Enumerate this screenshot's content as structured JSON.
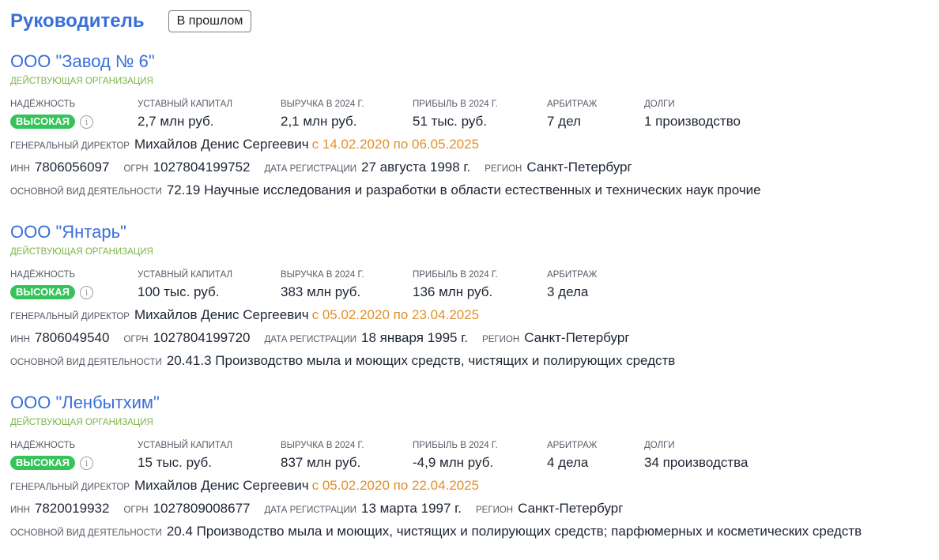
{
  "header": {
    "title": "Руководитель",
    "past_button": "В прошлом"
  },
  "labels": {
    "reliability": "НАДЁЖНОСТЬ",
    "capital": "УСТАВНЫЙ КАПИТАЛ",
    "revenue": "ВЫРУЧКА В 2024 Г.",
    "profit": "ПРИБЫЛЬ В 2024 Г.",
    "arbitration": "АРБИТРАЖ",
    "debts": "ДОЛГИ",
    "director": "ГЕНЕРАЛЬНЫЙ ДИРЕКТОР",
    "inn": "ИНН",
    "ogrn": "ОГРН",
    "reg_date": "ДАТА РЕГИСТРАЦИИ",
    "region": "РЕГИОН",
    "activity": "ОСНОВНОЙ ВИД ДЕЯТЕЛЬНОСТИ"
  },
  "companies": [
    {
      "name": "ООО \"Завод № 6\"",
      "status": "ДЕЙСТВУЮЩАЯ ОРГАНИЗАЦИЯ",
      "reliability": "ВЫСОКАЯ",
      "capital": "2,7 млн руб.",
      "revenue": "2,1 млн руб.",
      "profit": "51 тыс. руб.",
      "arbitration": "7 дел",
      "debts": "1 производство",
      "director": "Михайлов Денис Сергеевич",
      "period": "с 14.02.2020 по 06.05.2025",
      "inn": "7806056097",
      "ogrn": "1027804199752",
      "reg_date": "27 августа 1998 г.",
      "region": "Санкт-Петербург",
      "activity": "72.19 Научные исследования и разработки в области естественных и технических наук прочие"
    },
    {
      "name": "ООО \"Янтарь\"",
      "status": "ДЕЙСТВУЮЩАЯ ОРГАНИЗАЦИЯ",
      "reliability": "ВЫСОКАЯ",
      "capital": "100 тыс. руб.",
      "revenue": "383 млн руб.",
      "profit": "136 млн руб.",
      "arbitration": "3 дела",
      "director": "Михайлов Денис Сергеевич",
      "period": "с 05.02.2020 по 23.04.2025",
      "inn": "7806049540",
      "ogrn": "1027804199720",
      "reg_date": "18 января 1995 г.",
      "region": "Санкт-Петербург",
      "activity": "20.41.3 Производство мыла и моющих средств, чистящих и полирующих средств"
    },
    {
      "name": "ООО \"Ленбытхим\"",
      "status": "ДЕЙСТВУЮЩАЯ ОРГАНИЗАЦИЯ",
      "reliability": "ВЫСОКАЯ",
      "capital": "15 тыс. руб.",
      "revenue": "837 млн руб.",
      "profit": "-4,9 млн руб.",
      "arbitration": "4 дела",
      "debts": "34 производства",
      "director": "Михайлов Денис Сергеевич",
      "period": "с 05.02.2020 по 22.04.2025",
      "inn": "7820019932",
      "ogrn": "1027809008677",
      "reg_date": "13 марта 1997 г.",
      "region": "Санкт-Петербург",
      "activity": "20.4 Производство мыла и моющих, чистящих и полирующих средств; парфюмерных и косметических средств"
    }
  ],
  "icons": {
    "info": "info-icon"
  },
  "colors": {
    "link": "#3a6fd8",
    "status": "#7db44a",
    "badge": "#35c35a",
    "period": "#e0902a"
  }
}
